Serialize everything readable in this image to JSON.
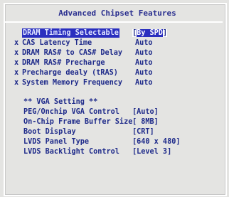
{
  "window": {
    "title": "Advanced Chipset Features"
  },
  "settings": [
    {
      "marker": "",
      "label": "DRAM Timing Selectable",
      "value": "By SPD",
      "selected": true
    },
    {
      "marker": "x",
      "label": "CAS Latency Time",
      "value": "Auto"
    },
    {
      "marker": "x",
      "label": "DRAM RAS# to CAS# Delay",
      "value": "Auto"
    },
    {
      "marker": "x",
      "label": "DRAM RAS# Precharge",
      "value": "Auto"
    },
    {
      "marker": "x",
      "label": "Precharge dealy (tRAS)",
      "value": "Auto"
    },
    {
      "marker": "x",
      "label": "System Memory Frequency",
      "value": "Auto"
    }
  ],
  "vga": {
    "section_title": "** VGA Setting **",
    "items": [
      {
        "label": "PEG/Onchip VGA Control",
        "value": "[Auto]"
      },
      {
        "label": "On-Chip Frame Buffer Size",
        "value": "[ 8MB]"
      },
      {
        "label": "Boot Display",
        "value": "[CRT]"
      },
      {
        "label": "LVDS Panel Type",
        "value": "[640 x 480]"
      },
      {
        "label": "LVDS Backlight Control",
        "value": "[Level 3]"
      }
    ]
  },
  "colors": {
    "background": "#e4e4e2",
    "text": "#1e2a8a",
    "highlight": "#2a2fbf"
  }
}
